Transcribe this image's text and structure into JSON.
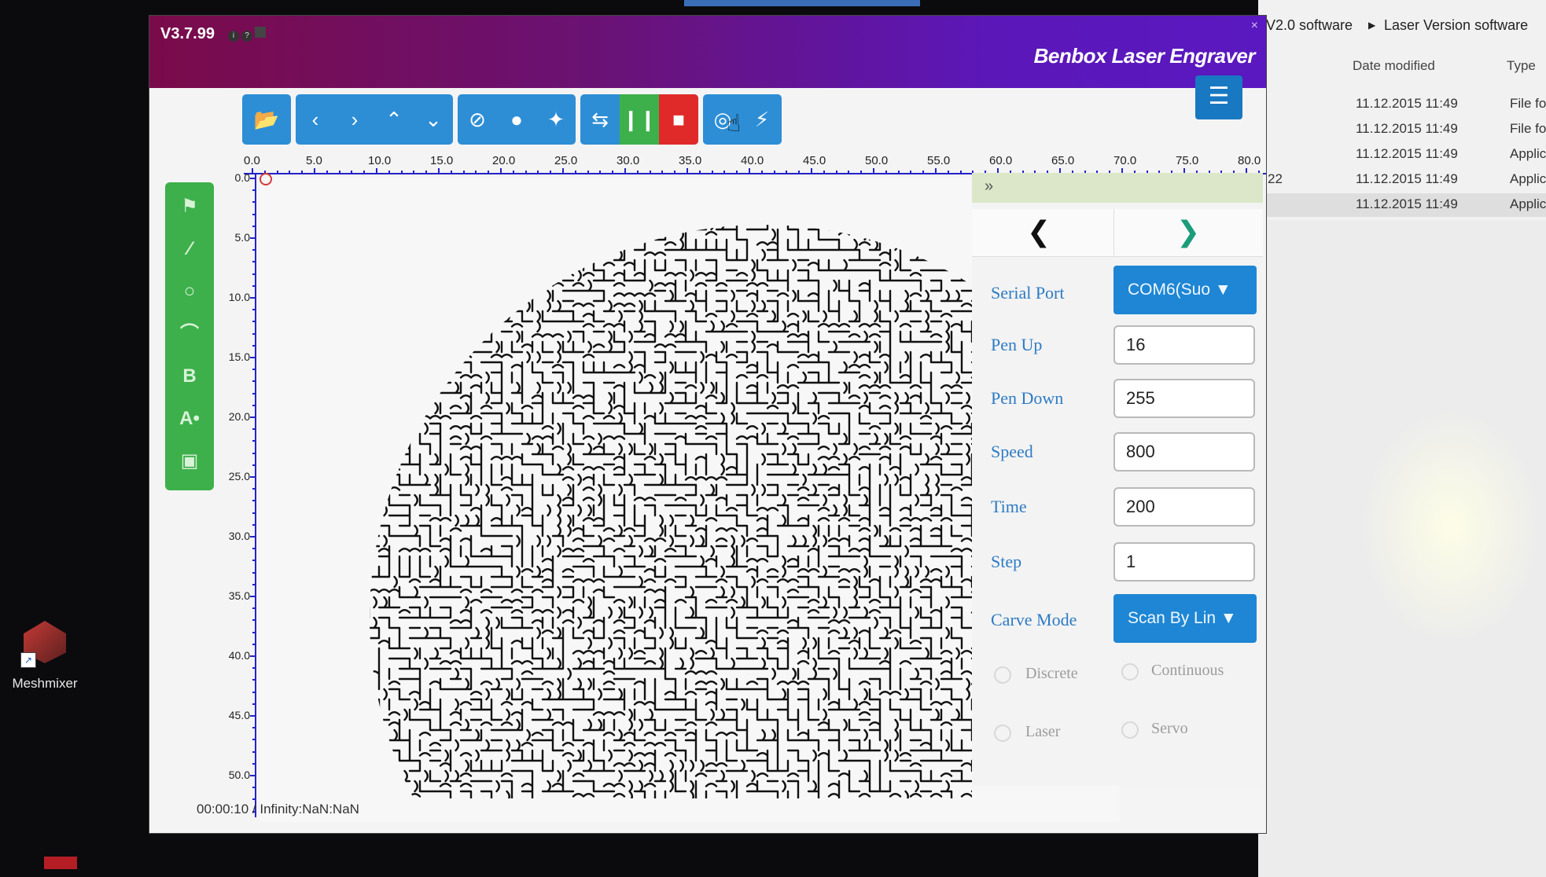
{
  "explorer": {
    "path_segments": [
      "t V2.0 software",
      "Laser Version software"
    ],
    "columns": {
      "date": "Date modified",
      "type": "Type"
    },
    "rows": [
      {
        "prefix": "",
        "date": "11.12.2015 11:49",
        "type": "File fo"
      },
      {
        "prefix": "",
        "date": "11.12.2015 11:49",
        "type": "File fo"
      },
      {
        "prefix": "",
        "date": "11.12.2015 11:49",
        "type": "Applic"
      },
      {
        "prefix": "22",
        "date": "11.12.2015 11:49",
        "type": "Applic"
      },
      {
        "prefix": "",
        "date": "11.12.2015 11:49",
        "type": "Applic"
      }
    ]
  },
  "desktop": {
    "icon_label": "Meshmixer"
  },
  "window": {
    "version": "V3.7.99",
    "title": "Benbox Laser Engraver"
  },
  "toolbar": {
    "icons": [
      "folder-open-icon",
      "arrow-left-icon",
      "arrow-right-icon",
      "arrow-up-icon",
      "arrow-down-icon",
      "cancel-icon",
      "dot-icon",
      "crosshair-icon",
      "repeat-icon",
      "pause-icon",
      "stop-icon",
      "target-icon",
      "lightning-icon"
    ]
  },
  "ruler": {
    "x_labels": [
      "0.0",
      "5.0",
      "10.0",
      "15.0",
      "20.0",
      "25.0",
      "30.0",
      "35.0",
      "40.0",
      "45.0",
      "50.0",
      "55.0",
      "60.0",
      "65.0",
      "70.0",
      "75.0",
      "80.0"
    ],
    "y_labels": [
      "0.0",
      "5.0",
      "10.0",
      "15.0",
      "20.0",
      "25.0",
      "30.0",
      "35.0",
      "40.0",
      "45.0",
      "50.0"
    ]
  },
  "side_tools": [
    "tag-icon",
    "line-icon",
    "circle-icon",
    "arc-icon",
    "B",
    "A•",
    "image-icon"
  ],
  "settings": {
    "collapse_glyph": "»",
    "serial_port_label": "Serial Port",
    "serial_port_value": "COM6(Suo",
    "pen_up_label": "Pen Up",
    "pen_up_value": "16",
    "pen_down_label": "Pen Down",
    "pen_down_value": "255",
    "speed_label": "Speed",
    "speed_value": "800",
    "time_label": "Time",
    "time_value": "200",
    "step_label": "Step",
    "step_value": "1",
    "carve_mode_label": "Carve Mode",
    "carve_mode_value": "Scan By Lin",
    "radio_discrete": "Discrete",
    "radio_continuous": "Continuous",
    "radio_laser": "Laser",
    "radio_servo": "Servo"
  },
  "status": {
    "text": "00:00:10 / Infinity:NaN:NaN"
  },
  "colors": {
    "title_gradient_start": "#7a0b4a",
    "title_gradient_end": "#5a18c0",
    "toolbar_blue": "#2d8ed6",
    "accent_green": "#3db04b",
    "stop_red": "#e02a2a",
    "ruler_blue": "#2323c8",
    "label_blue": "#2d7bc4"
  }
}
